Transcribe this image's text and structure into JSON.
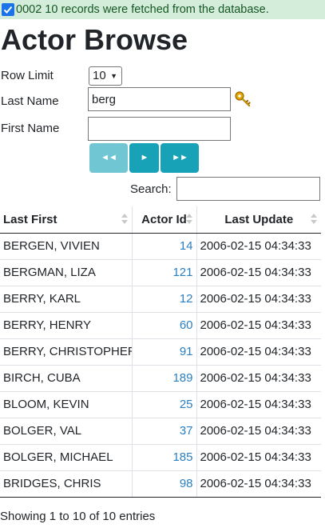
{
  "status": {
    "message": "0002 10 records were fetched from the database.",
    "background": "#d4edda",
    "text_color": "#155724"
  },
  "page": {
    "title": "Actor Browse"
  },
  "form": {
    "row_limit_label": "Row Limit",
    "row_limit_value": "10",
    "last_name_label": "Last Name",
    "last_name_value": "berg",
    "first_name_label": "First Name",
    "first_name_value": "",
    "lookup_icon": "key-icon"
  },
  "pager": {
    "first_label": "◄◄",
    "next_label": "►",
    "last_label": "►►",
    "accent": "#17a2b8"
  },
  "search": {
    "label": "Search:",
    "value": ""
  },
  "table": {
    "columns": [
      "Last First",
      "Actor Id",
      "Last Update"
    ],
    "rows": [
      {
        "name": "BERGEN, VIVIEN",
        "id": "14",
        "updated": "2006-02-15 04:34:33"
      },
      {
        "name": "BERGMAN, LIZA",
        "id": "121",
        "updated": "2006-02-15 04:34:33"
      },
      {
        "name": "BERRY, KARL",
        "id": "12",
        "updated": "2006-02-15 04:34:33"
      },
      {
        "name": "BERRY, HENRY",
        "id": "60",
        "updated": "2006-02-15 04:34:33"
      },
      {
        "name": "BERRY, CHRISTOPHER",
        "id": "91",
        "updated": "2006-02-15 04:34:33"
      },
      {
        "name": "BIRCH, CUBA",
        "id": "189",
        "updated": "2006-02-15 04:34:33"
      },
      {
        "name": "BLOOM, KEVIN",
        "id": "25",
        "updated": "2006-02-15 04:34:33"
      },
      {
        "name": "BOLGER, VAL",
        "id": "37",
        "updated": "2006-02-15 04:34:33"
      },
      {
        "name": "BOLGER, MICHAEL",
        "id": "185",
        "updated": "2006-02-15 04:34:33"
      },
      {
        "name": "BRIDGES, CHRIS",
        "id": "98",
        "updated": "2006-02-15 04:34:33"
      }
    ],
    "id_color": "#2a7fc1"
  },
  "footer": {
    "info": "Showing 1 to 10 of 10 entries"
  }
}
